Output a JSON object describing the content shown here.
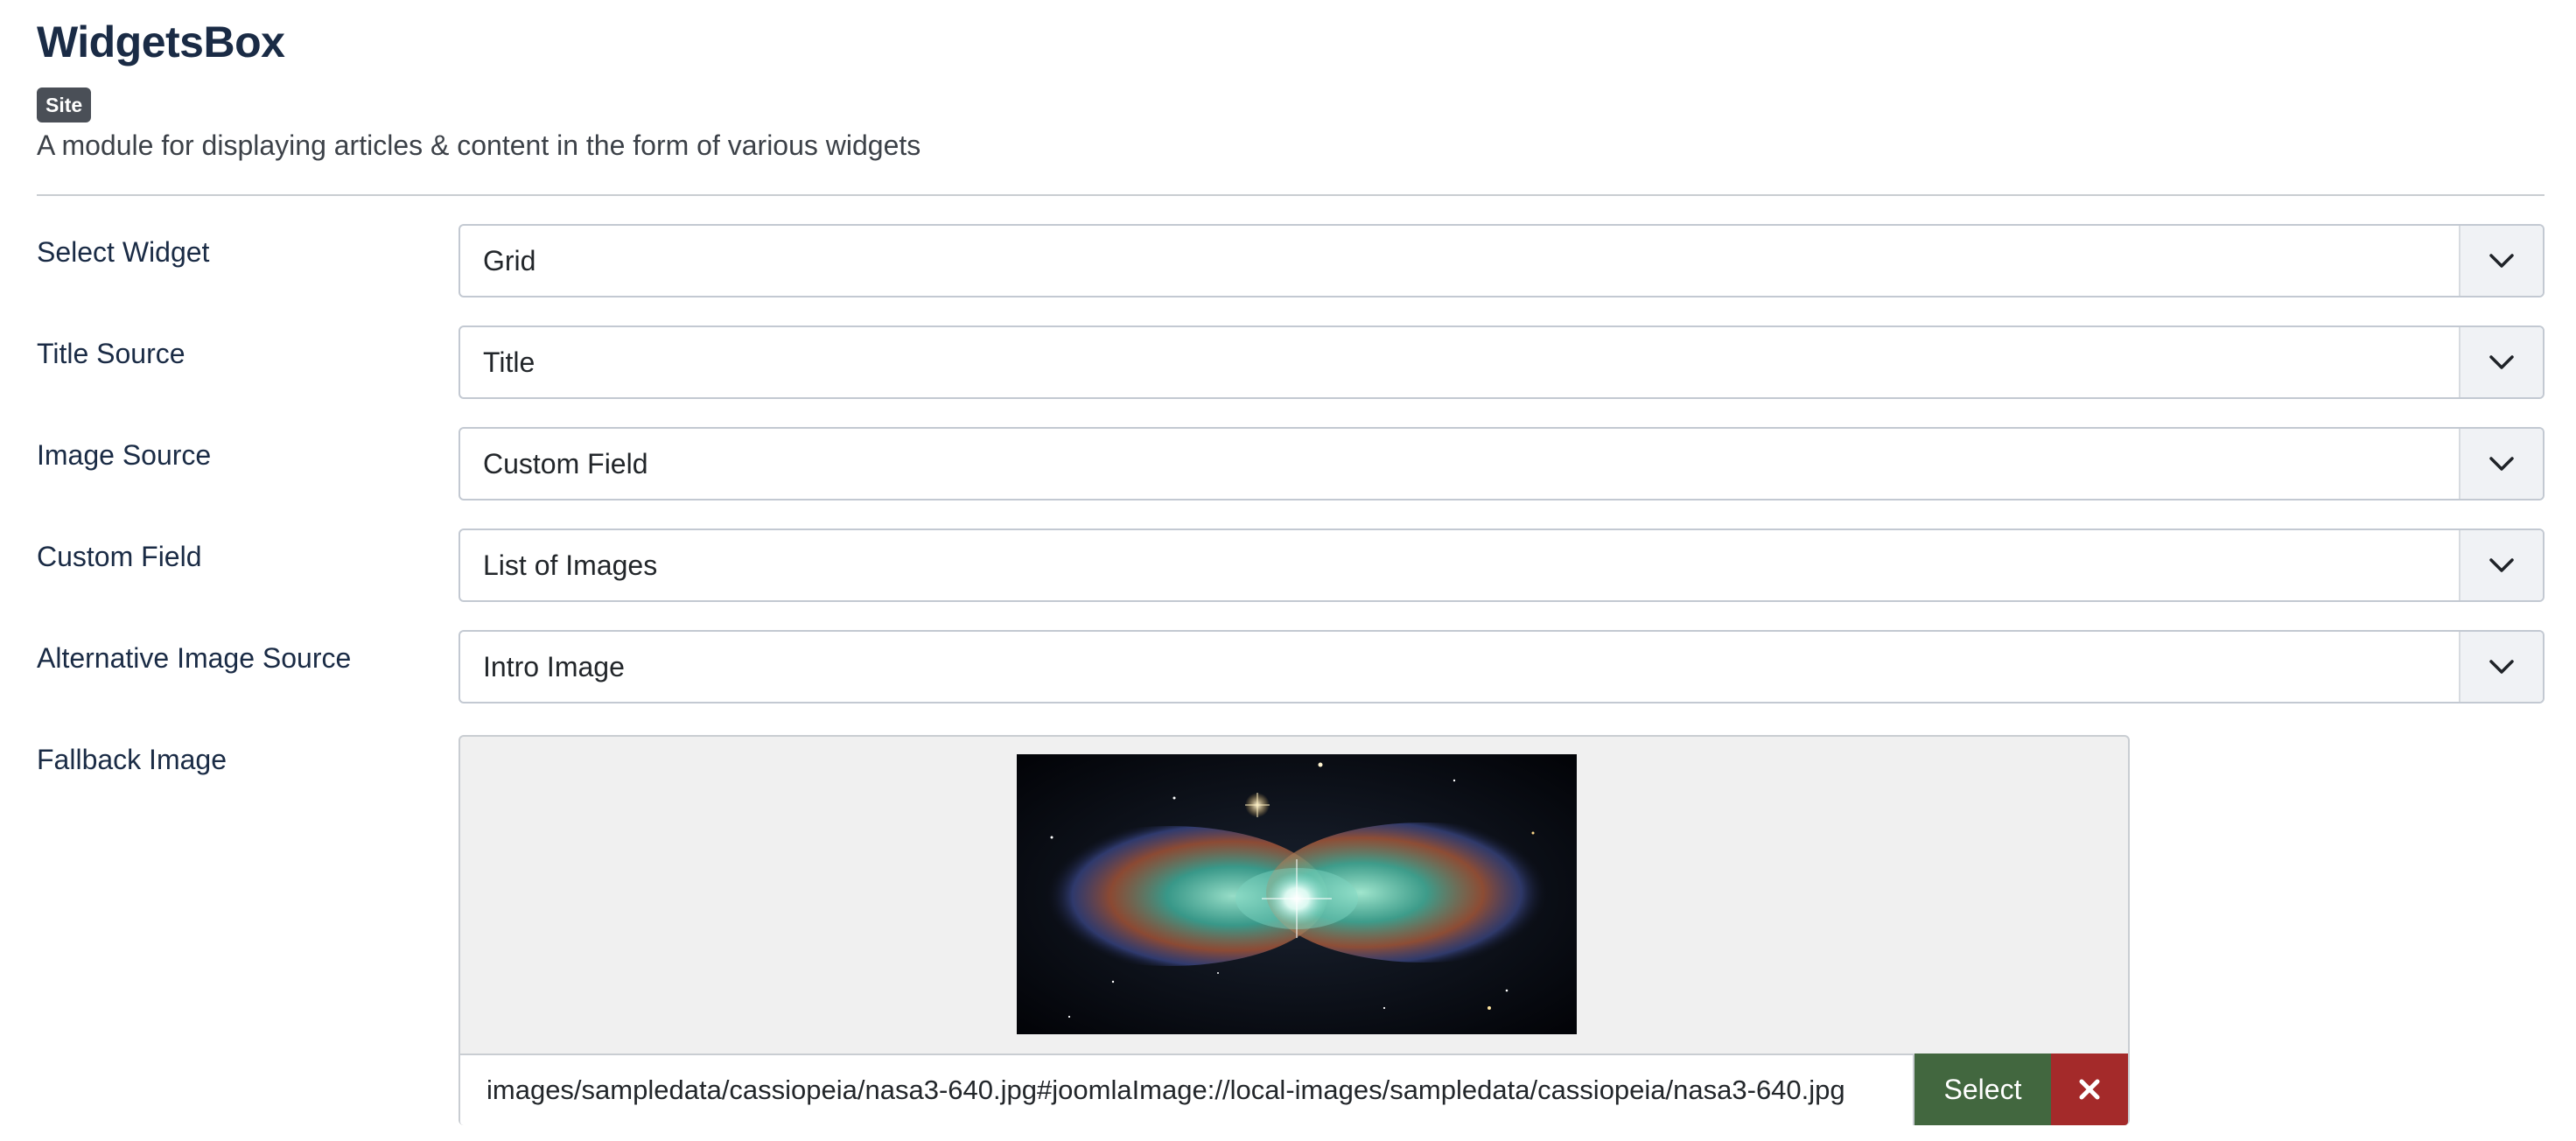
{
  "header": {
    "title": "WidgetsBox",
    "badge": "Site",
    "description": "A module for displaying articles & content in the form of various widgets"
  },
  "fields": [
    {
      "label": "Select Widget",
      "value": "Grid"
    },
    {
      "label": "Title Source",
      "value": "Title"
    },
    {
      "label": "Image Source",
      "value": "Custom Field"
    },
    {
      "label": "Custom Field",
      "value": "List of Images"
    },
    {
      "label": "Alternative Image Source",
      "value": "Intro Image"
    }
  ],
  "fallback": {
    "label": "Fallback Image",
    "path": "images/sampledata/cassiopeia/nasa3-640.jpg#joomlaImage://local-images/sampledata/cassiopeia/nasa3-640.jpg",
    "select_label": "Select",
    "clear_icon": "close-icon"
  },
  "colors": {
    "title": "#1a2b45",
    "badge_bg": "#4a4f57",
    "select_button": "#42673f",
    "clear_button": "#a42a2a"
  }
}
